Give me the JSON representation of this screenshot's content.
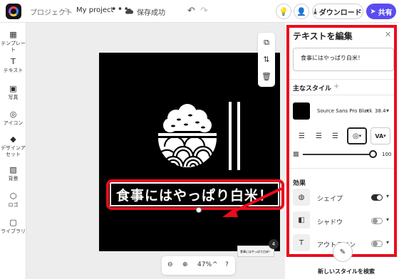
{
  "header": {
    "breadcrumb_root": "プロジェクト",
    "breadcrumb_sep": ">",
    "project_name": "My project",
    "more_label": "•••",
    "save_status": "保存成功",
    "download_label": "ダウンロード",
    "share_label": "共有"
  },
  "sidebar": {
    "items": [
      {
        "label": "テンプレート",
        "icon": "template-icon"
      },
      {
        "label": "テキスト",
        "icon": "text-icon"
      },
      {
        "label": "写真",
        "icon": "photo-icon"
      },
      {
        "label": "アイコン",
        "icon": "icon-icon"
      },
      {
        "label": "デザインアセット",
        "icon": "design-asset-icon"
      },
      {
        "label": "背景",
        "icon": "background-icon"
      },
      {
        "label": "ロゴ",
        "icon": "logo-icon"
      },
      {
        "label": "ライブラリ",
        "icon": "library-icon"
      }
    ]
  },
  "canvas": {
    "banner_text": "食事にはやっぱり白米！",
    "page_count": "4",
    "thumb_text": "食事にはやっぱり白米！"
  },
  "zoom": {
    "zoom_out": "⊖",
    "zoom_in": "⊕",
    "level": "47%",
    "chevron": "^",
    "help": "?"
  },
  "panel": {
    "title": "テキストを編集",
    "text_value": "食事にはやっぱり白米！",
    "main_style_label": "主なスタイル",
    "font_name": "Source Sans Pro Black",
    "font_size": "38.4",
    "opacity_value": "100",
    "effects_label": "効果",
    "effects": [
      {
        "label": "シェイプ",
        "state": "on"
      },
      {
        "label": "シャドウ",
        "state": "off"
      },
      {
        "label": "アウトライン",
        "state": "off"
      }
    ],
    "find_styles": "新しいスタイルを検索",
    "text_color": "#000000"
  },
  "colors": {
    "accent": "#5a4cf0",
    "highlight": "#ea0c1c"
  }
}
